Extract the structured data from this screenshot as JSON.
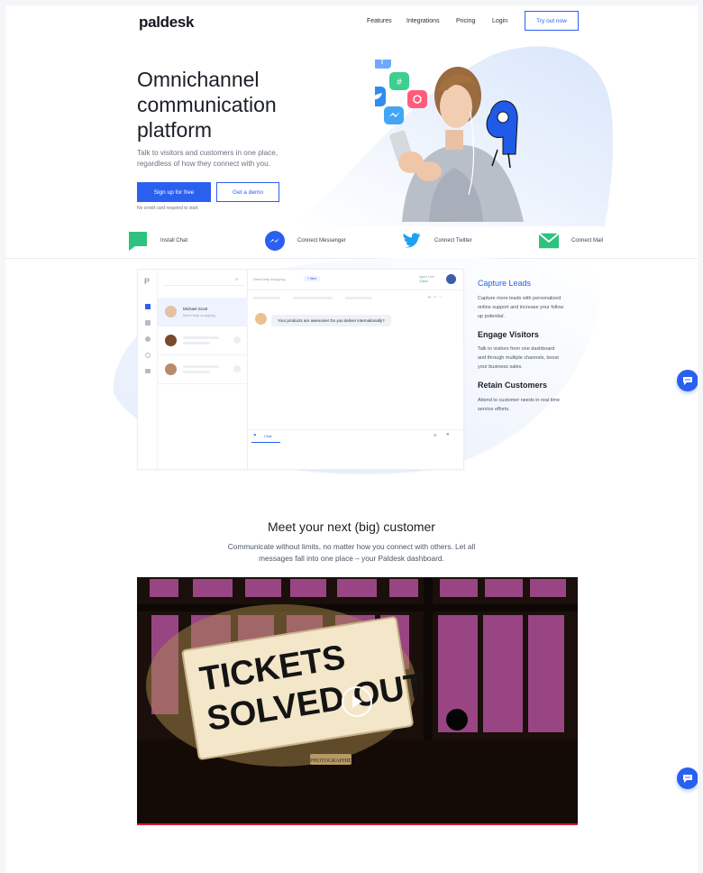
{
  "brand": {
    "logo": "paldesk",
    "accent": "#2a60f0"
  },
  "nav": {
    "items": [
      "Features",
      "Integrations",
      "Pricing",
      "Login"
    ],
    "cta": "Try out now"
  },
  "hero": {
    "title_lines": [
      "Omnichannel",
      "communication",
      "platform"
    ],
    "subtitle_lines": [
      "Talk to visitors and customers in one place,",
      "regardless of how they connect with you."
    ],
    "primary_button": "Sign up for free",
    "secondary_button": "Get a demo",
    "note": "No credit card required to start."
  },
  "channels": [
    {
      "label": "Install Chat",
      "icon": "chat-flag-icon",
      "color": "#2ec27e"
    },
    {
      "label": "Connect Messenger",
      "icon": "messenger-icon",
      "color": "#2a60f0"
    },
    {
      "label": "Connect Twitter",
      "icon": "twitter-icon",
      "color": "#1da1f2"
    },
    {
      "label": "Connect Mail",
      "icon": "mail-icon",
      "color": "#2ec27e"
    }
  ],
  "dashboard": {
    "logo_letter": "P",
    "conversation_name": "Michael Scott",
    "conversation_preview": "Need help shopping",
    "tab_label": "Need help shopping",
    "new_label": "+ New",
    "agent_status_label": "Agent Live",
    "agent_status": "Online",
    "message": "Your products are awesome! Do you deliver internationally?",
    "composer_tab": "Chat"
  },
  "features": [
    {
      "title": "Capture Leads",
      "lines": [
        "Capture more leads with personalized",
        "online support and increase your follow",
        "up potential."
      ]
    },
    {
      "title": "Engage Visitors",
      "lines": [
        "Talk to visitors from one dashboard",
        "and through multiple channels, boost",
        "your business sales."
      ]
    },
    {
      "title": "Retain Customers",
      "lines": [
        "Attend to customer needs in real time",
        "service efforts."
      ]
    }
  ],
  "meet": {
    "title": "Meet your next (big) customer",
    "subtitle_lines": [
      "Communicate without limits, no matter how you connect with others. Let all",
      "messages fall into one place – your Paldesk dashboard."
    ]
  },
  "video": {
    "sign_lines": [
      "TICKETS",
      "SOLVED OUT"
    ],
    "plaque": "PHOTOGRAPHIE"
  }
}
